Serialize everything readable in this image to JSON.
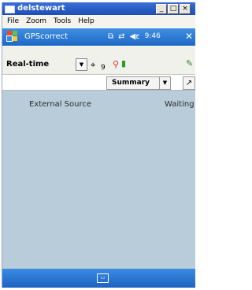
{
  "window": {
    "title": "delstewart",
    "buttons": {
      "minimize": "_",
      "maximize": "□",
      "close": "×"
    }
  },
  "menu": {
    "items": [
      "File",
      "Zoom",
      "Tools",
      "Help"
    ]
  },
  "app_bar": {
    "title": "GPScorrect",
    "time": "9:46",
    "icons": [
      "copy-icon",
      "sync-icon",
      "speaker-icon",
      "close-icon"
    ],
    "close_label": "✕"
  },
  "toolbar": {
    "mode": "Real-time",
    "satellite_count": "9",
    "icons": [
      "satellite-icon",
      "antenna-icon",
      "battery-icon",
      "pen-icon"
    ]
  },
  "summary": {
    "selected": "Summary"
  },
  "content": {
    "rows": [
      {
        "label": "External Source",
        "value": "Waiting"
      }
    ],
    "background": "#b8ccd9"
  },
  "colors": {
    "title_bar": "#1d4eb5",
    "app_bar": "#1f68c6",
    "bottom_bar": "#1d63c2"
  }
}
